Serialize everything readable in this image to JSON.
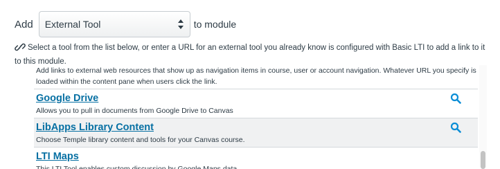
{
  "header": {
    "add_label": "Add",
    "item_type_select": {
      "selected": "External Tool"
    },
    "to_module_label": "to module"
  },
  "instructions": "Select a tool from the list below, or enter a URL for an external tool you already know is configured with Basic LTI to add a link to it to this module.",
  "tools": {
    "partial_top": {
      "description": "Add links to external web resources that show up as navigation items in course, user or account navigation. Whatever URL you specify is loaded within the content pane when users click the link."
    },
    "items": [
      {
        "name": "Google Drive",
        "description": "Allows you to pull in documents from Google Drive to Canvas"
      },
      {
        "name": "LibApps Library Content",
        "description": "Choose Temple library content and tools for your Canvas course."
      },
      {
        "name": "LTI Maps",
        "description": "This LTI Tool enables custom discussion by Google Maps data"
      }
    ]
  },
  "colors": {
    "link": "#0770a3",
    "search_icon": "#0a8dd6",
    "selected_row": "#f0f1f2"
  },
  "icons": {
    "link": "link-icon",
    "search": "search-icon",
    "select_arrows": "select-arrows-icon"
  }
}
